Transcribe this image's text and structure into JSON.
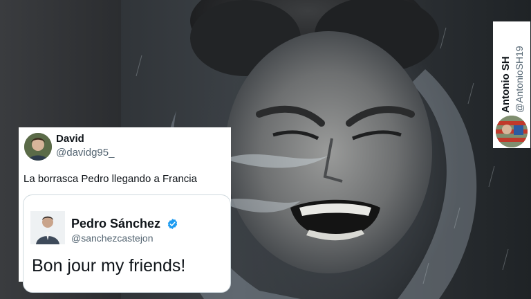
{
  "tweet": {
    "author_name": "David",
    "author_handle": "@davidg95_",
    "text": "La borrasca Pedro llegando a Francia",
    "quoted": {
      "author_name": "Pedro Sánchez",
      "author_handle": "@sanchezcastejon",
      "verified": true,
      "text": "Bon jour my friends!"
    }
  },
  "credit": {
    "name": "Antonio SH",
    "handle": "@AntonioSH19"
  },
  "colors": {
    "verified_badge": "#1d9bf0",
    "text_primary": "#0f1419",
    "text_secondary": "#536471"
  }
}
